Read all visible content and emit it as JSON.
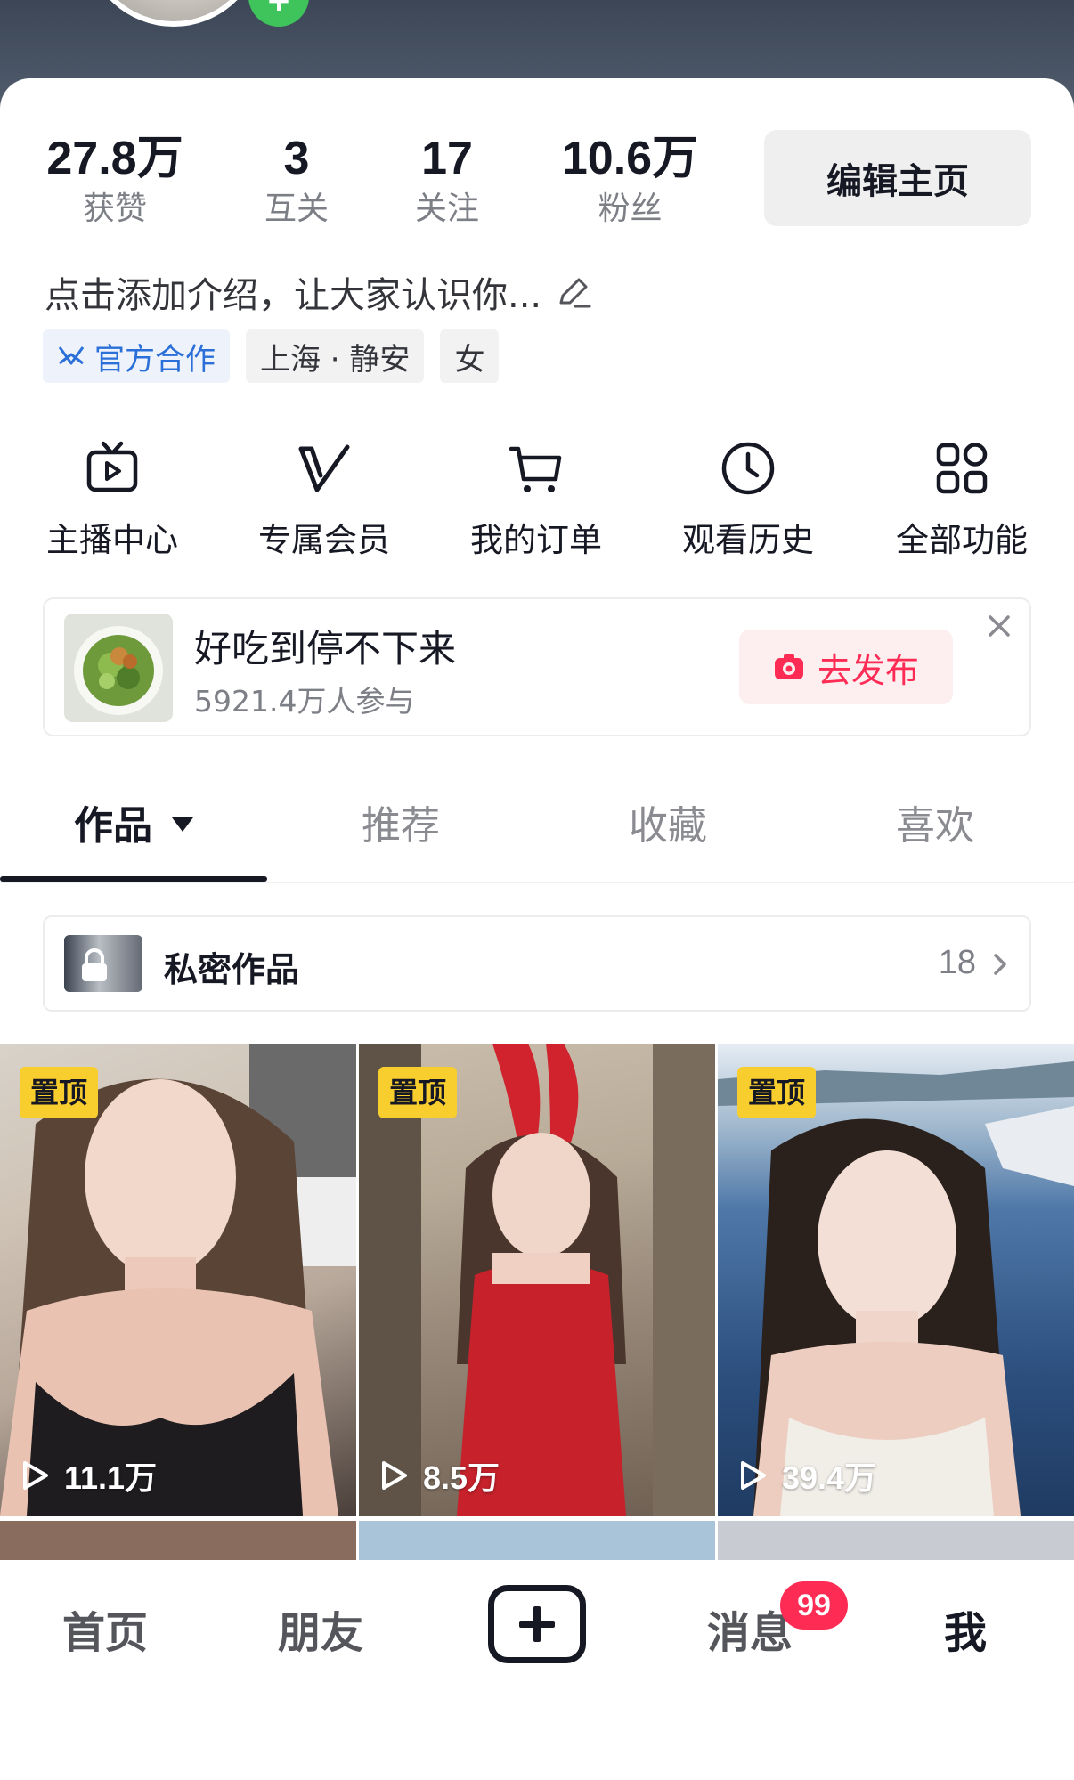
{
  "profile": {
    "stats": [
      {
        "value": "27.8万",
        "label": "获赞"
      },
      {
        "value": "3",
        "label": "互关"
      },
      {
        "value": "17",
        "label": "关注"
      },
      {
        "value": "10.6万",
        "label": "粉丝"
      }
    ],
    "edit_button": "编辑主页",
    "intro": "点击添加介绍，让大家认识你...",
    "tags": {
      "official": "官方合作",
      "location": "上海 · 静安",
      "gender": "女"
    }
  },
  "functions": [
    {
      "label": "主播中心",
      "icon": "live-tv-icon"
    },
    {
      "label": "专属会员",
      "icon": "v-member-icon"
    },
    {
      "label": "我的订单",
      "icon": "cart-icon"
    },
    {
      "label": "观看历史",
      "icon": "clock-icon"
    },
    {
      "label": "全部功能",
      "icon": "grid-icon"
    }
  ],
  "banner": {
    "title": "好吃到停不下来",
    "participants": "5921.4万人参与",
    "publish_label": "去发布"
  },
  "tabs": [
    {
      "label": "作品",
      "active": true
    },
    {
      "label": "推荐"
    },
    {
      "label": "收藏"
    },
    {
      "label": "喜欢"
    }
  ],
  "private_works": {
    "label": "私密作品",
    "count": "18"
  },
  "videos": [
    {
      "pinned_label": "置顶",
      "plays": "11.1万"
    },
    {
      "pinned_label": "置顶",
      "plays": "8.5万"
    },
    {
      "pinned_label": "置顶",
      "plays": "39.4万"
    }
  ],
  "bottom_nav": {
    "home": "首页",
    "friends": "朋友",
    "messages": "消息",
    "messages_badge": "99",
    "me": "我"
  },
  "colors": {
    "accent": "#fe2c55",
    "pin_badge": "#f8cd2e",
    "official_blue": "#2b6fd8",
    "text_primary": "#161823",
    "text_secondary": "#7d7f86"
  }
}
